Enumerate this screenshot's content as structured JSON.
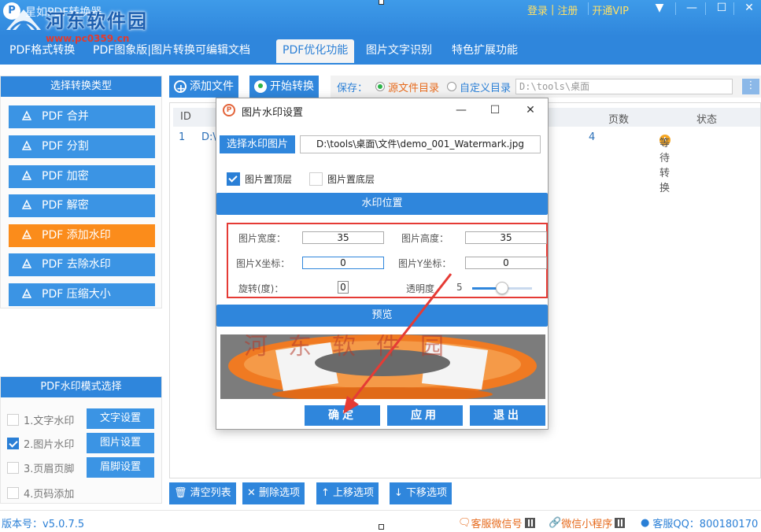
{
  "window": {
    "logo_letter": "P",
    "title": "星如PDF转换器",
    "watermark_site": "河东软件园",
    "watermark_url": "www.pc0359.cn",
    "login": "登录",
    "register": "注册",
    "vip": "开通VIP",
    "sep": "|"
  },
  "menu": {
    "tabs": [
      {
        "label": "PDF格式转换"
      },
      {
        "label": "PDF图象版|图片转换可编辑文档"
      },
      {
        "label": "PDF优化功能"
      },
      {
        "label": "图片文字识别"
      },
      {
        "label": "特色扩展功能"
      }
    ]
  },
  "left": {
    "header": "选择转换类型",
    "items": [
      {
        "label": "PDF 合并"
      },
      {
        "label": "PDF 分割"
      },
      {
        "label": "PDF 加密"
      },
      {
        "label": "PDF 解密"
      },
      {
        "label": "PDF 添加水印"
      },
      {
        "label": "PDF 去除水印"
      },
      {
        "label": "PDF 压缩大小"
      }
    ]
  },
  "mode": {
    "header": "PDF水印模式选择",
    "rows": [
      {
        "label": "1.文字水印",
        "button": "文字设置"
      },
      {
        "label": "2.图片水印",
        "button": "图片设置"
      },
      {
        "label": "3.页眉页脚",
        "button": "眉脚设置"
      },
      {
        "label": "4.页码添加"
      }
    ]
  },
  "toolbar": {
    "add_file": "添加文件",
    "start": "开始转换",
    "save_label": "保存：",
    "opt_source": "源文件目录",
    "opt_custom": "自定义目录",
    "path": "D:\\tools\\桌面",
    "more": "⋮"
  },
  "table": {
    "headers": {
      "id": "ID",
      "pages": "页数",
      "status": "状态"
    },
    "rows": [
      {
        "id": "1",
        "name": "D:\\",
        "pages": "4",
        "status": "等待转换"
      }
    ]
  },
  "bottom": {
    "clear": "清空列表",
    "delete": "删除选项",
    "up": "上移选项",
    "down": "下移选项",
    "version": "版本号：v5.0.7.5",
    "wechat": "客服微信号",
    "mini": "微信小程序",
    "qq": "客服QQ：800180170"
  },
  "dialog": {
    "title": "图片水印设置",
    "choose": "选择水印图片",
    "image_path": "D:\\tools\\桌面\\文件\\demo_001_Watermark.jpg",
    "top_layer": "图片置顶层",
    "bottom_layer": "图片置底层",
    "position_bar": "水印位置",
    "width_label": "图片宽度：",
    "width": "35",
    "height_label": "图片高度：",
    "height": "35",
    "x_label": "图片X坐标：",
    "x": "0",
    "y_label": "图片Y坐标：",
    "y": "0",
    "rotate_label": "旋转(度)：",
    "rotate": "0",
    "opacity_label": "透明度",
    "opacity": "5",
    "opacity_fraction": 0.5,
    "preview_bar": "预览",
    "preview_watermark_text": "河东软件园",
    "ok": "确定",
    "apply": "应用",
    "exit": "退出"
  },
  "colors": {
    "accent": "#2f86dc",
    "active_item": "#fb8c1b",
    "highlight_box": "#e53b35",
    "arrow": "#e53b35"
  }
}
